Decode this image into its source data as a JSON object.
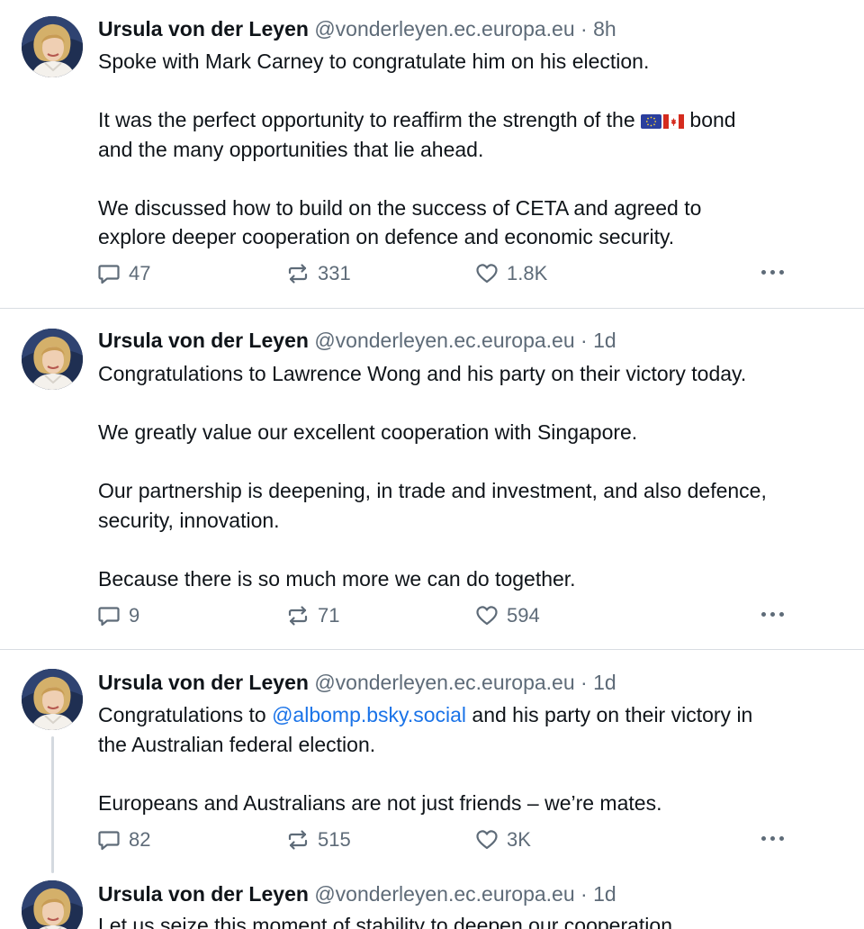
{
  "colors": {
    "text": "#0f1419",
    "muted": "#5e6b78",
    "link": "#1a73e8",
    "divider": "#d8dde2"
  },
  "posts": [
    {
      "author": "Ursula von der Leyen",
      "handle": "@vonderleyen.ec.europa.eu",
      "sep": "·",
      "time": "8h",
      "lines": [
        "Spoke with Mark Carney to congratulate him on his election.",
        "",
        "It was the perfect opportunity to reaffirm the strength of the 🇪🇺🇨🇦 bond",
        "and the many opportunities that lie ahead.",
        "",
        "We discussed how to build on the success of CETA and  agreed to",
        "explore deeper cooperation on defence and economic security."
      ],
      "line3_prefix": "It was the perfect opportunity to reaffirm the strength of the",
      "line3_suffix": "bond",
      "replies": "47",
      "reposts": "331",
      "likes": "1.8K"
    },
    {
      "author": "Ursula von der Leyen",
      "handle": "@vonderleyen.ec.europa.eu",
      "sep": "·",
      "time": "1d",
      "lines": [
        "Congratulations to Lawrence Wong and his party on their victory today.",
        "",
        "We greatly value our excellent cooperation with Singapore.",
        "",
        "Our partnership is deepening, in trade and investment, and also defence,",
        "security, innovation.",
        "",
        "Because there is so much more we can do together."
      ],
      "replies": "9",
      "reposts": "71",
      "likes": "594"
    },
    {
      "author": "Ursula von der Leyen",
      "handle": "@vonderleyen.ec.europa.eu",
      "sep": "·",
      "time": "1d",
      "line1_prefix": "Congratulations to",
      "mention": "@albomp.bsky.social",
      "line1_suffix": "and his party on their victory in",
      "lines": [
        "the Australian federal election.",
        "",
        "Europeans and Australians are not just friends – we’re mates."
      ],
      "replies": "82",
      "reposts": "515",
      "likes": "3K"
    },
    {
      "author": "Ursula von der Leyen",
      "handle": "@vonderleyen.ec.europa.eu",
      "sep": "·",
      "time": "1d",
      "lines": [
        "Let us seize this moment of stability to deepen our cooperation"
      ]
    }
  ],
  "icons": {
    "reply": "reply-icon",
    "repost": "repost-icon",
    "like": "heart-icon",
    "more": "more-options-icon",
    "flag_eu": "eu-flag-icon",
    "flag_ca": "canada-flag-icon"
  }
}
